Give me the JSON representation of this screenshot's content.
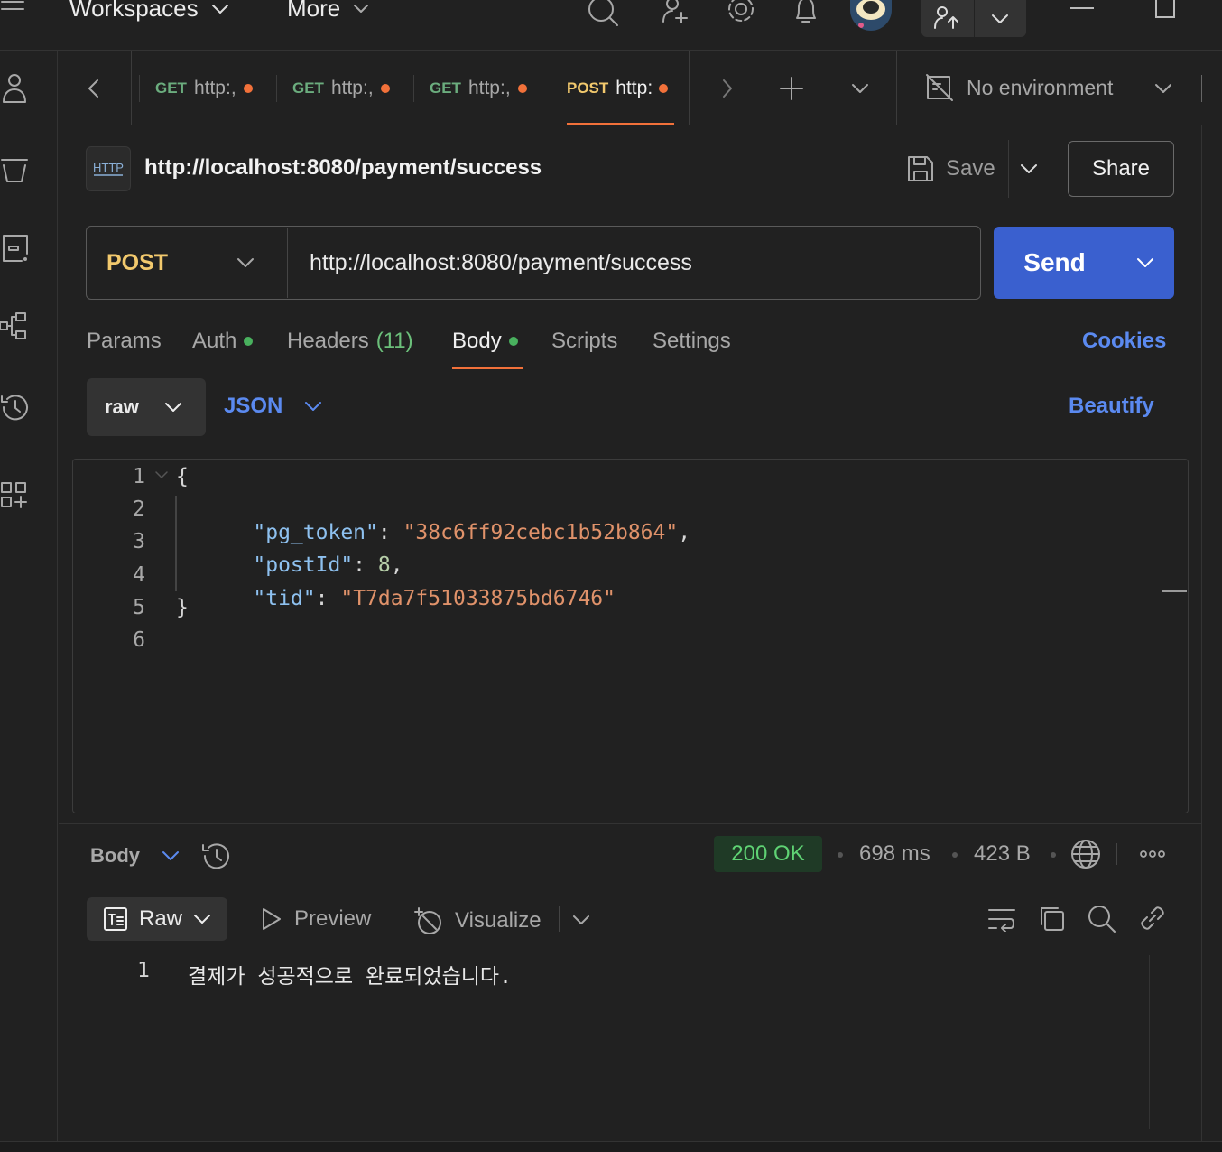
{
  "topbar": {
    "workspaces": "Workspaces",
    "more": "More"
  },
  "tabs": [
    {
      "method": "GET",
      "url": "http:,"
    },
    {
      "method": "GET",
      "url": "http:,"
    },
    {
      "method": "GET",
      "url": "http:,"
    },
    {
      "method": "POST",
      "url": "http:"
    }
  ],
  "environment": "No environment",
  "request": {
    "title": "http://localhost:8080/payment/success",
    "save": "Save",
    "share": "Share",
    "method": "POST",
    "url": "http://localhost:8080/payment/success",
    "send": "Send"
  },
  "request_tabs": {
    "params": "Params",
    "auth": "Auth",
    "headers": "Headers",
    "headers_count": "(11)",
    "body": "Body",
    "scripts": "Scripts",
    "settings": "Settings",
    "cookies": "Cookies"
  },
  "body_mode": {
    "mode": "raw",
    "format": "JSON",
    "beautify": "Beautify"
  },
  "editor": {
    "line_numbers": [
      "1",
      "2",
      "3",
      "4",
      "5",
      "6"
    ],
    "open_brace": "{",
    "close_brace": "}",
    "k1": "\"pg_token\"",
    "v1": "\"38c6ff92cebc1b52b864\"",
    "k2": "\"postId\"",
    "v2": "8",
    "k3": "\"tid\"",
    "v3": "\"T7da7f51033875bd6746\""
  },
  "response": {
    "body_label": "Body",
    "status": "200 OK",
    "time": "698 ms",
    "size": "423 B",
    "views": {
      "raw": "Raw",
      "preview": "Preview",
      "visualize": "Visualize"
    },
    "line_number": "1",
    "text": "결제가 성공적으로 완료되었습니다."
  },
  "colors": {
    "accent": "#3a60cf",
    "link": "#5b8af0",
    "post": "#f2c96d",
    "get": "#6bad7e",
    "unsaved_dot": "#f2713a",
    "status_ok": "#5fd374"
  }
}
